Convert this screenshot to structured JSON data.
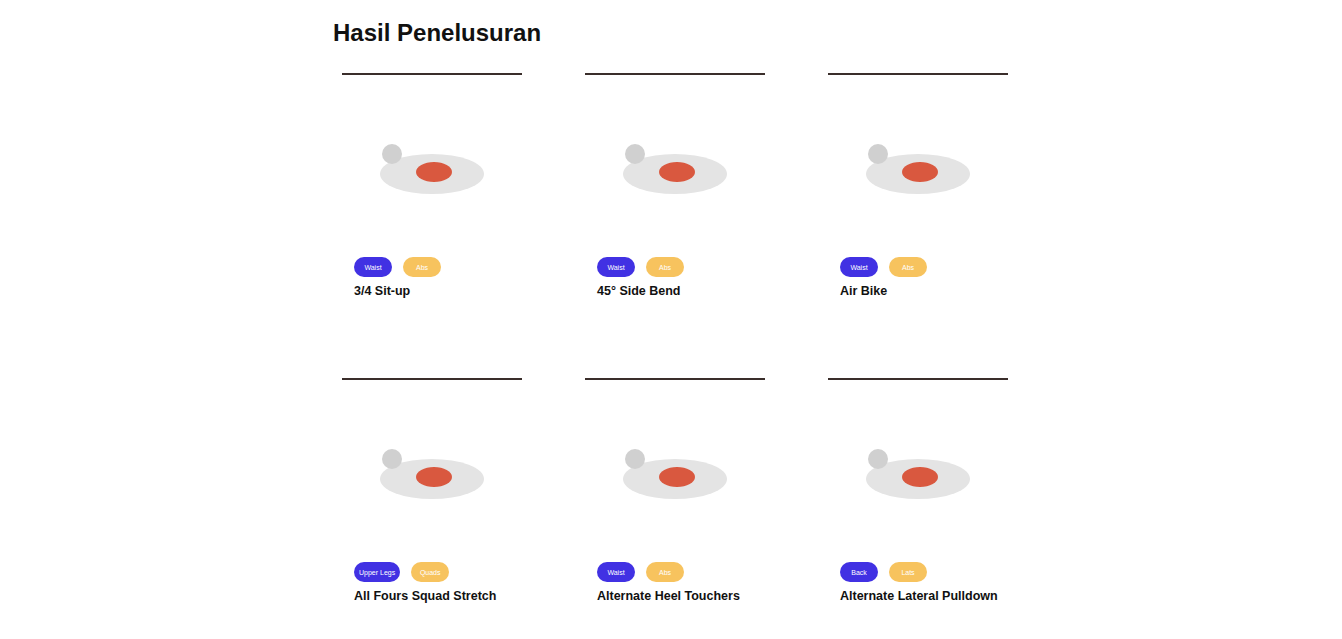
{
  "title": "Hasil Penelusuran",
  "exercises": [
    {
      "name": "3/4 Sit-up",
      "tags": [
        {
          "label": "Waist",
          "color": "#4131e3"
        },
        {
          "label": "Abs",
          "color": "#f7c35e"
        }
      ]
    },
    {
      "name": "45° Side Bend",
      "tags": [
        {
          "label": "Waist",
          "color": "#4131e3"
        },
        {
          "label": "Abs",
          "color": "#f7c35e"
        }
      ]
    },
    {
      "name": "Air Bike",
      "tags": [
        {
          "label": "Waist",
          "color": "#4131e3"
        },
        {
          "label": "Abs",
          "color": "#f7c35e"
        }
      ]
    },
    {
      "name": "All Fours Squad Stretch",
      "tags": [
        {
          "label": "Upper Legs",
          "color": "#4131e3"
        },
        {
          "label": "Quads",
          "color": "#f7c35e"
        }
      ]
    },
    {
      "name": "Alternate Heel Touchers",
      "tags": [
        {
          "label": "Waist",
          "color": "#4131e3"
        },
        {
          "label": "Abs",
          "color": "#f7c35e"
        }
      ]
    },
    {
      "name": "Alternate Lateral Pulldown",
      "tags": [
        {
          "label": "Back",
          "color": "#4131e3"
        },
        {
          "label": "Lats",
          "color": "#f7c35e"
        }
      ]
    }
  ]
}
